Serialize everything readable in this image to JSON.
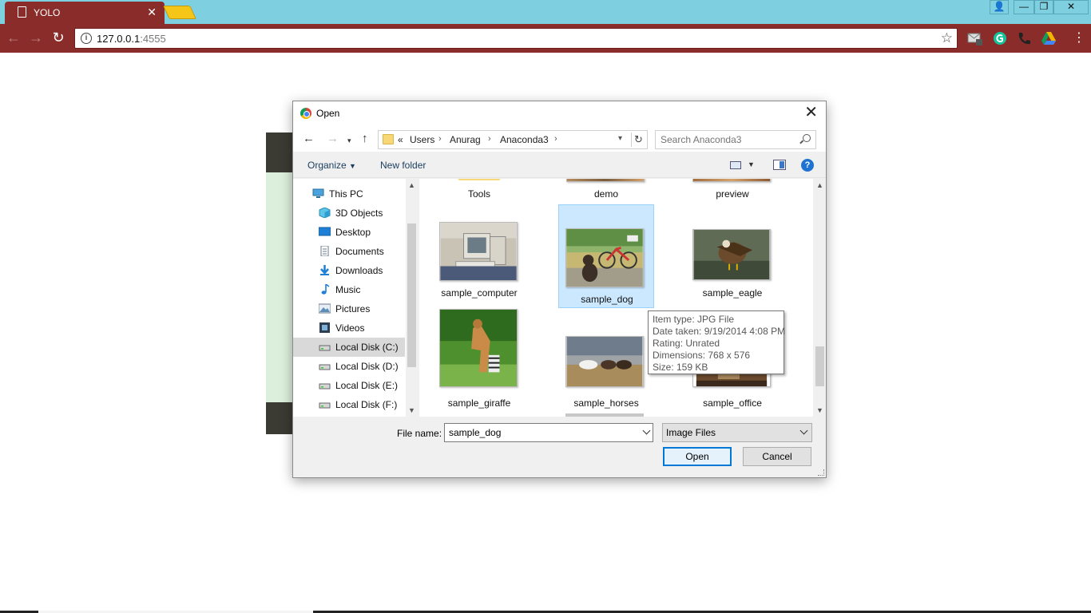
{
  "browser": {
    "tab_title": "YOLO",
    "url_host": "127.0.0.1",
    "url_port": ":4555"
  },
  "dialog": {
    "title": "Open",
    "breadcrumb": [
      "«",
      "Users",
      "Anurag",
      "Anaconda3"
    ],
    "search_placeholder": "Search Anaconda3",
    "organize_label": "Organize",
    "new_folder_label": "New folder",
    "nav_items": [
      {
        "label": "This PC",
        "icon": "this-pc-icon",
        "top": true
      },
      {
        "label": "3D Objects",
        "icon": "3d-objects-icon"
      },
      {
        "label": "Desktop",
        "icon": "desktop-icon"
      },
      {
        "label": "Documents",
        "icon": "documents-icon"
      },
      {
        "label": "Downloads",
        "icon": "downloads-icon"
      },
      {
        "label": "Music",
        "icon": "music-icon"
      },
      {
        "label": "Pictures",
        "icon": "pictures-icon"
      },
      {
        "label": "Videos",
        "icon": "videos-icon"
      },
      {
        "label": "Local Disk (C:)",
        "icon": "drive-icon",
        "selected": true
      },
      {
        "label": "Local Disk (D:)",
        "icon": "drive-icon"
      },
      {
        "label": "Local Disk (E:)",
        "icon": "drive-icon"
      },
      {
        "label": "Local Disk (F:)",
        "icon": "drive-icon"
      }
    ],
    "files": [
      {
        "name": "Tools"
      },
      {
        "name": "demo"
      },
      {
        "name": "preview"
      },
      {
        "name": "sample_computer"
      },
      {
        "name": "sample_dog",
        "selected": true
      },
      {
        "name": "sample_eagle"
      },
      {
        "name": "sample_giraffe"
      },
      {
        "name": "sample_horses"
      },
      {
        "name": "sample_office"
      }
    ],
    "tooltip": {
      "item_type": "Item type: JPG File",
      "date_taken": "Date taken: 9/19/2014 4:08 PM",
      "rating": "Rating: Unrated",
      "dimensions": "Dimensions: 768 x 576",
      "size": "Size: 159 KB"
    },
    "file_name_label": "File name:",
    "file_name_value": "sample_dog",
    "file_type_value": "Image Files",
    "open_label": "Open",
    "cancel_label": "Cancel"
  }
}
